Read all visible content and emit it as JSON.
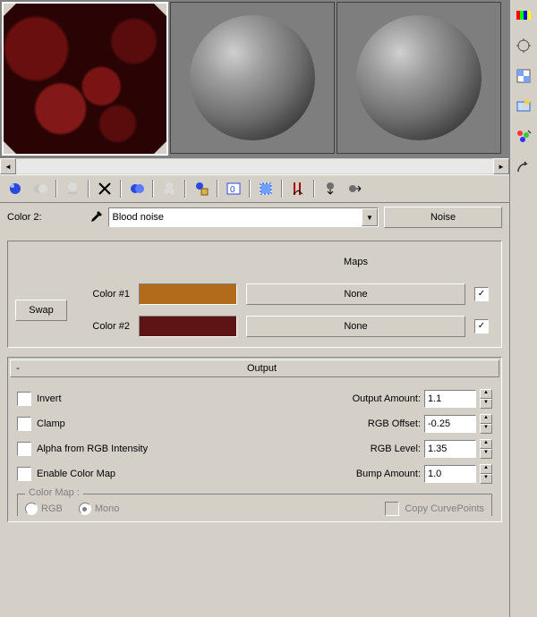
{
  "labels": {
    "color2": "Color 2:",
    "map_name": "Blood noise",
    "map_type": "Noise",
    "maps_header": "Maps",
    "color1_label": "Color #1",
    "color2_label": "Color #2",
    "swap": "Swap",
    "none1": "None",
    "none2": "None",
    "output_rollout": "Output",
    "minus": "-",
    "invert": "Invert",
    "clamp": "Clamp",
    "alpha_rgb": "Alpha from RGB Intensity",
    "enable_cmap": "Enable Color Map",
    "output_amount": "Output Amount:",
    "rgb_offset": "RGB Offset:",
    "rgb_level": "RGB Level:",
    "bump_amount": "Bump Amount:",
    "color_map_group": "Color Map :",
    "rgb_radio": "RGB",
    "mono_radio": "Mono",
    "copy_curve": "Copy CurvePoints"
  },
  "values": {
    "output_amount": "1.1",
    "rgb_offset": "-0.25",
    "rgb_level": "1.35",
    "bump_amount": "1.0"
  },
  "checks": {
    "map1": "✓",
    "map2": "✓"
  },
  "chart_data": {
    "type": "table",
    "title": "Noise map output parameters",
    "rows": [
      {
        "param": "Output Amount",
        "value": 1.1
      },
      {
        "param": "RGB Offset",
        "value": -0.25
      },
      {
        "param": "RGB Level",
        "value": 1.35
      },
      {
        "param": "Bump Amount",
        "value": 1.0
      }
    ],
    "flags": {
      "Invert": false,
      "Clamp": false,
      "Alpha from RGB Intensity": false,
      "Enable Color Map": false
    },
    "color_swatches": {
      "Color #1": "#B26A1B",
      "Color #2": "#5E1414"
    }
  }
}
